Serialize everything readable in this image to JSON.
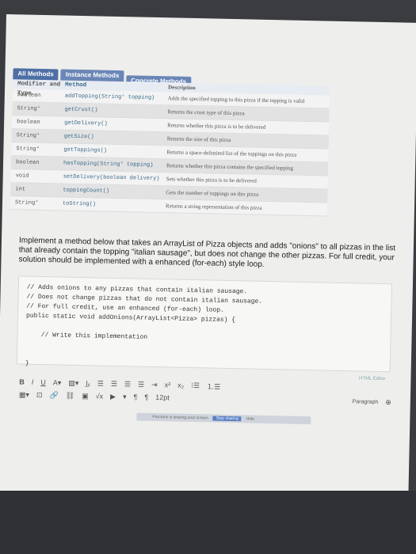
{
  "tabs": [
    {
      "label": "All Methods"
    },
    {
      "label": "Instance Methods"
    },
    {
      "label": "Concrete Methods"
    }
  ],
  "table": {
    "headers": {
      "modifier": "Modifier and Type",
      "method": "Method",
      "description": "Description"
    },
    "rows": [
      {
        "type": "boolean",
        "method": "addTopping(String° topping)",
        "desc": "Adds the specified topping to this pizza if the topping is valid"
      },
      {
        "type": "String°",
        "method": "getCrust()",
        "desc": "Returns the crust type of this pizza"
      },
      {
        "type": "boolean",
        "method": "getDelivery()",
        "desc": "Returns whether this pizza is to be delivered"
      },
      {
        "type": "String°",
        "method": "getSize()",
        "desc": "Returns the size of this pizza"
      },
      {
        "type": "String°",
        "method": "getToppings()",
        "desc": "Returns a space-delimited list of the toppings on this pizza"
      },
      {
        "type": "boolean",
        "method": "hasTopping(String° topping)",
        "desc": "Returns whether this pizza contains the specified topping"
      },
      {
        "type": "void",
        "method": "setDelivery(boolean delivery)",
        "desc": "Sets whether this pizza is to be delivered"
      },
      {
        "type": "int",
        "method": "toppingCount()",
        "desc": "Gets the number of toppings on this pizza"
      },
      {
        "type": "String°",
        "method": "toString()",
        "desc": "Returns a string representation of this pizza"
      }
    ]
  },
  "question": "Implement a method below that takes an ArrayList of Pizza objects and adds \"onions\" to all pizzas in the list that already contain the topping \"italian sausage\", but does not change the other pizzas. For full credit, your solution should be implemented with a enhanced (for-each) style loop.",
  "code": "// Adds onions to any pizzas that contain italian sausage.\n// Does not change pizzas that do not contain italian sausage.\n// For full credit, use an enhanced (for-each) loop.\npublic static void addOnions(ArrayList<Pizza> pizzas) {\n\n    // Write this implementation\n\n\n}",
  "editor": {
    "html_editor_label": "HTML Editor",
    "paragraph_label": "Paragraph",
    "font_size": "12pt",
    "status_text": "Proctorio is sharing your screen",
    "stop_label": "Stop sharing",
    "hide_label": "Hide"
  }
}
